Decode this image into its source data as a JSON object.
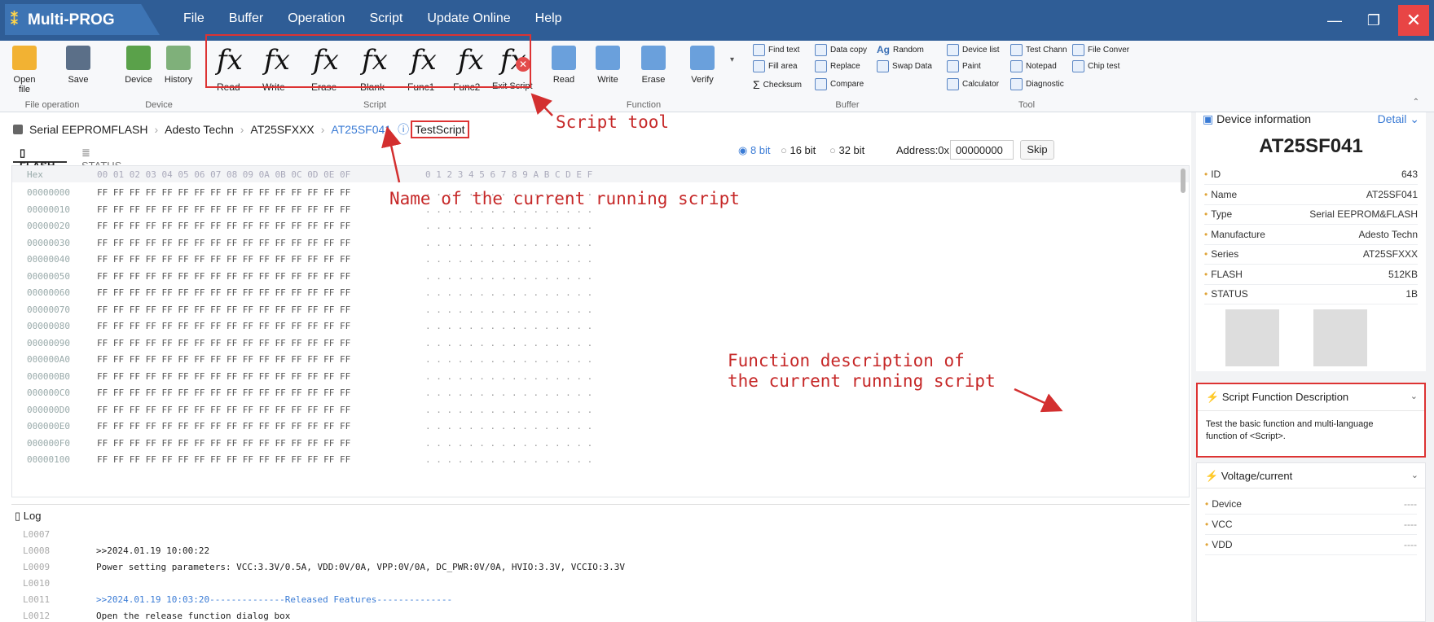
{
  "app": {
    "title": "Multi-PROG",
    "menu": [
      "File",
      "Buffer",
      "Operation",
      "Script",
      "Update Online",
      "Help"
    ]
  },
  "ribbon": {
    "file": [
      {
        "label": "Open file"
      },
      {
        "label": "Save"
      }
    ],
    "file_group": "File operation",
    "device": [
      {
        "label": "Device"
      },
      {
        "label": "History"
      }
    ],
    "device_group": "Device",
    "script": [
      "Read",
      "Write",
      "Erase",
      "Blank",
      "Func1",
      "Func2",
      "Exit Script"
    ],
    "script_group": "Script",
    "function": [
      "Read",
      "Write",
      "Erase",
      "Verify"
    ],
    "function_group": "Function",
    "buffer": [
      "Find text",
      "Fill area",
      "Checksum",
      "Data copy",
      "Replace",
      "Compare",
      "Random",
      "Swap Data"
    ],
    "buffer_group": "Buffer",
    "tool": [
      "Device list",
      "Paint",
      "Calculator",
      "Test Chann",
      "Notepad",
      "Diagnostic",
      "File Conver",
      "Chip test"
    ],
    "tool_group": "Tool"
  },
  "breadcrumb": [
    "Serial EEPROMFLASH",
    "Adesto Techn",
    "AT25SFXXX",
    "AT25SF041"
  ],
  "current_script": "TestScript",
  "tabs": [
    "FLASH",
    "STATUS"
  ],
  "bit_options": [
    "8 bit",
    "16 bit",
    "32 bit"
  ],
  "address": {
    "label": "Address:0x",
    "value": "00000000",
    "skip": "Skip"
  },
  "hex": {
    "head_addr": "Hex",
    "head_cols": "00 01 02 03 04 05 06 07 08 09 0A 0B 0C 0D 0E 0F",
    "head_ascii": "0 1 2 3 4 5 6 7 8 9 A B C D E F",
    "rows": [
      "00000000",
      "00000010",
      "00000020",
      "00000030",
      "00000040",
      "00000050",
      "00000060",
      "00000070",
      "00000080",
      "00000090",
      "000000A0",
      "000000B0",
      "000000C0",
      "000000D0",
      "000000E0",
      "000000F0",
      "00000100"
    ],
    "row_bytes": "FF FF FF FF FF FF FF FF FF FF FF FF FF FF FF FF",
    "row_ascii": ". . . . . . . . . . . . . . . ."
  },
  "log": {
    "title": "Log",
    "lines": [
      {
        "n": "L0007",
        "t": ""
      },
      {
        "n": "L0008",
        "t": ">>2024.01.19 10:00:22"
      },
      {
        "n": "L0009",
        "t": "Power setting parameters: VCC:3.3V/0.5A, VDD:0V/0A, VPP:0V/0A, DC_PWR:0V/0A, HVIO:3.3V, VCCIO:3.3V"
      },
      {
        "n": "L0010",
        "t": ""
      },
      {
        "n": "L0011",
        "t": ">>2024.01.19 10:03:20--------------Released Features--------------"
      },
      {
        "n": "L0012",
        "t": "Open the release function dialog box"
      }
    ]
  },
  "device_info": {
    "title": "Device information",
    "detail": "Detail",
    "name": "AT25SF041",
    "props": [
      {
        "k": "ID",
        "v": "643"
      },
      {
        "k": "Name",
        "v": "AT25SF041"
      },
      {
        "k": "Type",
        "v": "Serial EEPROM&FLASH"
      },
      {
        "k": "Manufacture",
        "v": "Adesto Techn"
      },
      {
        "k": "Series",
        "v": "AT25SFXXX"
      },
      {
        "k": "FLASH",
        "v": "512KB"
      },
      {
        "k": "STATUS",
        "v": "1B"
      }
    ]
  },
  "script_desc": {
    "title": "Script Function Description",
    "text": "Test the basic function and multi-language function of <Script>."
  },
  "voltage": {
    "title": "Voltage/current",
    "props": [
      {
        "k": "Device",
        "v": "----"
      },
      {
        "k": "VCC",
        "v": "----"
      },
      {
        "k": "VDD",
        "v": "----"
      }
    ]
  },
  "annotations": {
    "script_tool": "Script tool",
    "script_name": "Name of the current running script",
    "desc1": "Function description of",
    "desc2": "the current running script"
  },
  "colors": {
    "title_bar": "#2f5d96",
    "annotation": "#c62828",
    "accent": "#3a7bd5"
  }
}
